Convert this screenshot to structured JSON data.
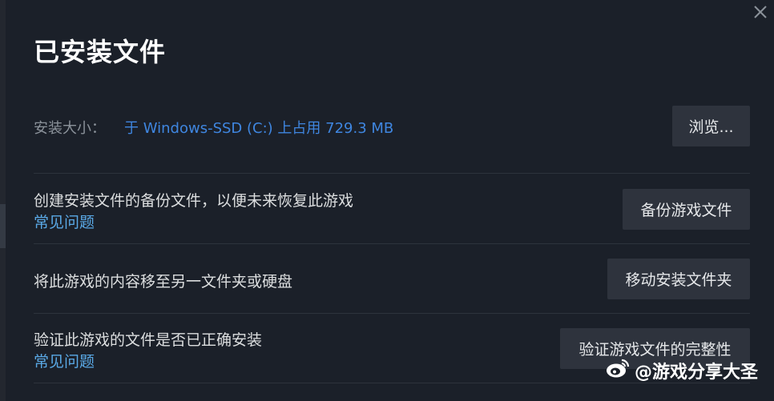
{
  "dialog": {
    "title": "已安装文件",
    "close_icon": "close-icon"
  },
  "install_size": {
    "label": "安装大小：",
    "value": "于 Windows-SSD (C:) 上占用 729.3 MB",
    "browse_label": "浏览..."
  },
  "rows": [
    {
      "text": "创建安装文件的备份文件，以便未来恢复此游戏",
      "faq": "常见问题",
      "button": "备份游戏文件"
    },
    {
      "text": "将此游戏的内容移至另一文件夹或硬盘",
      "button": "移动安装文件夹"
    },
    {
      "text": "验证此游戏的文件是否已正确安装",
      "faq": "常见问题",
      "button": "验证游戏文件的完整性"
    }
  ],
  "watermark": {
    "text": "@游戏分享大圣",
    "icon": "weibo-icon"
  },
  "colors": {
    "background": "#1b2029",
    "link_blue": "#3f86e0",
    "faq_blue": "#5aa9e6",
    "button_bg": "#2e333d"
  }
}
